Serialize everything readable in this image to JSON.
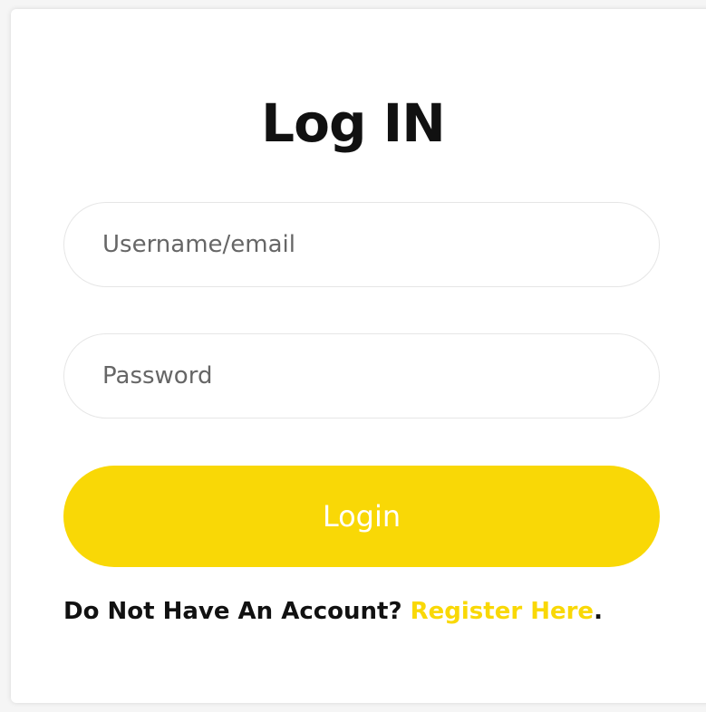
{
  "form": {
    "title": "Log IN",
    "username_placeholder": "Username/email",
    "password_placeholder": "Password",
    "submit_label": "Login",
    "register_prompt": "Do Not Have An Account?",
    "register_link": "Register Here",
    "register_suffix": "."
  },
  "colors": {
    "accent": "#f9d806",
    "text": "#111111",
    "placeholder": "#666666",
    "border": "#e6e6e6"
  }
}
